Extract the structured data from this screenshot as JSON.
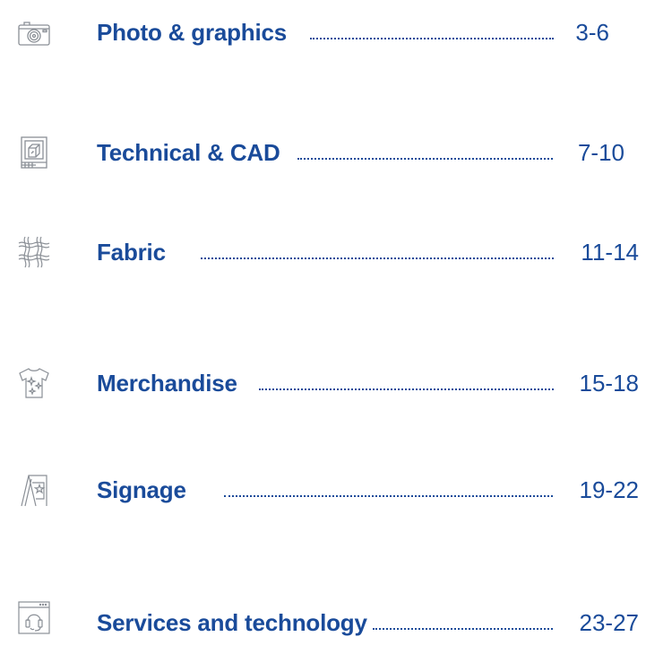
{
  "toc": {
    "entries": [
      {
        "title": "Photo & graphics",
        "pages": "3-6",
        "icon": "camera-icon"
      },
      {
        "title": "Technical & CAD",
        "pages": "7-10",
        "icon": "cad-drawing-icon"
      },
      {
        "title": "Fabric",
        "pages": "11-14",
        "icon": "fabric-weave-icon"
      },
      {
        "title": "Merchandise",
        "pages": "15-18",
        "icon": "tshirt-icon"
      },
      {
        "title": "Signage",
        "pages": "19-22",
        "icon": "sandwich-board-sign-icon"
      },
      {
        "title": "Services and technology",
        "pages": "23-27",
        "icon": "headset-support-icon"
      }
    ]
  },
  "colors": {
    "accent": "#1a4b9a",
    "icon_stroke": "#8a8f96"
  }
}
